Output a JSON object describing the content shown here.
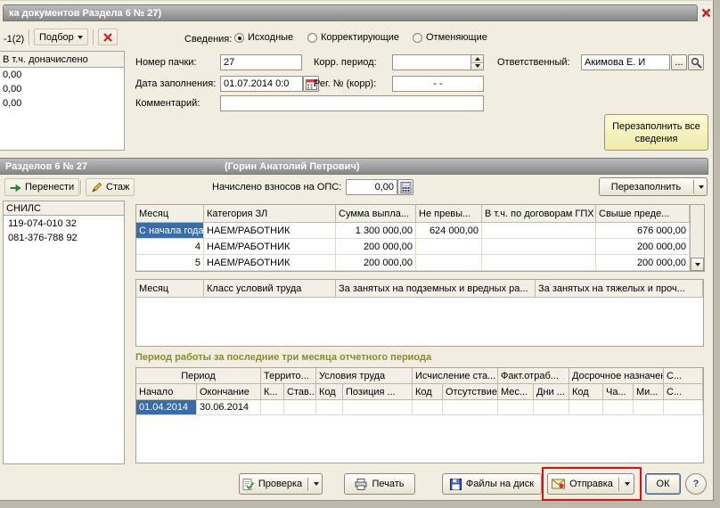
{
  "window": {
    "title": "ка документов Раздела 6 № 27)"
  },
  "colors": {
    "selection_blue": "#3a6ca8",
    "annotation_red": "#e30b0b",
    "section_label_olive": "#8a8a2e"
  },
  "top_toolbar": {
    "pager_label": "-1(2)",
    "podbor_button": "Подбор"
  },
  "svedeniya": {
    "label": "Сведения:",
    "options": [
      {
        "label": "Исходные",
        "selected": true
      },
      {
        "label": "Корректирующие",
        "selected": false
      },
      {
        "label": "Отменяющие",
        "selected": false
      }
    ]
  },
  "left_table": {
    "header": "В т.ч. доначислено",
    "rows": [
      "0,00",
      "0,00",
      "0,00"
    ]
  },
  "form": {
    "pack_number": {
      "label": "Номер пачки:",
      "value": "27"
    },
    "corr_period": {
      "label": "Корр. период:",
      "value": ""
    },
    "responsible": {
      "label": "Ответственный:",
      "value": "Акимова Е. И",
      "ellipsis_button": "..."
    },
    "fill_date": {
      "label": "Дата заполнения:",
      "value": "01.07.2014 0:0"
    },
    "reg_number": {
      "label": "Рег. № (корр):",
      "value": "-    -"
    },
    "comment": {
      "label": "Комментарий:",
      "value": ""
    },
    "refill_all_button": "Перезаполнить все сведения"
  },
  "section6": {
    "title": "Разделов 6 № 27",
    "person": "(Горин Анатолий Петрович)",
    "transfer_button": "Перенести",
    "stazh_button": "Стаж",
    "ops_label": "Начислено взносов на ОПС:",
    "ops_value": "0,00",
    "refill_button": "Перезаполнить"
  },
  "snils_panel": {
    "header": "СНИЛС",
    "rows": [
      "119-074-010 32",
      "081-376-788 92"
    ]
  },
  "payments_table": {
    "columns": [
      "Месяц",
      "Категория ЗЛ",
      "Сумма выпла...",
      "Не превы...",
      "В т.ч. по договорам ГПХ",
      "Свыше преде..."
    ],
    "rows": [
      [
        "С начала года",
        "НАЕМ/РАБОТНИК",
        "1 300 000,00",
        "624 000,00",
        "",
        "676 000,00"
      ],
      [
        "4",
        "НАЕМ/РАБОТНИК",
        "200 000,00",
        "",
        "",
        "200 000,00"
      ],
      [
        "5",
        "НАЕМ/РАБОТНИК",
        "200 000,00",
        "",
        "",
        "200 000,00"
      ]
    ]
  },
  "conditions_table": {
    "columns": [
      "Месяц",
      "Класс условий труда",
      "За занятых на подземных и вредных ра...",
      "За занятых на тяжелых и проч..."
    ]
  },
  "period_table": {
    "section_title": "Период работы за последние три месяца отчетного периода",
    "groups": [
      "Период",
      "Террито...",
      "Условия труда",
      "Исчисление ста...",
      "Факт.отраб...",
      "Досрочное назначение",
      "С..."
    ],
    "columns": [
      "Начало",
      "Окончание",
      "К...",
      "Став...",
      "Код",
      "Позиция ...",
      "Код",
      "Отсутствие",
      "Мес...",
      "Дни ...",
      "Код",
      "Ча...",
      "Ми...",
      "С..."
    ],
    "rows": [
      [
        "01.04.2014",
        "30.06.2014",
        "",
        "",
        "",
        "",
        "",
        "",
        "",
        "",
        "",
        "",
        "",
        ""
      ]
    ]
  },
  "footer": {
    "check_button": "Проверка",
    "print_button": "Печать",
    "files_button": "Файлы на диск",
    "send_button": "Отправка",
    "ok_button": "ОК",
    "help_button": "?"
  }
}
